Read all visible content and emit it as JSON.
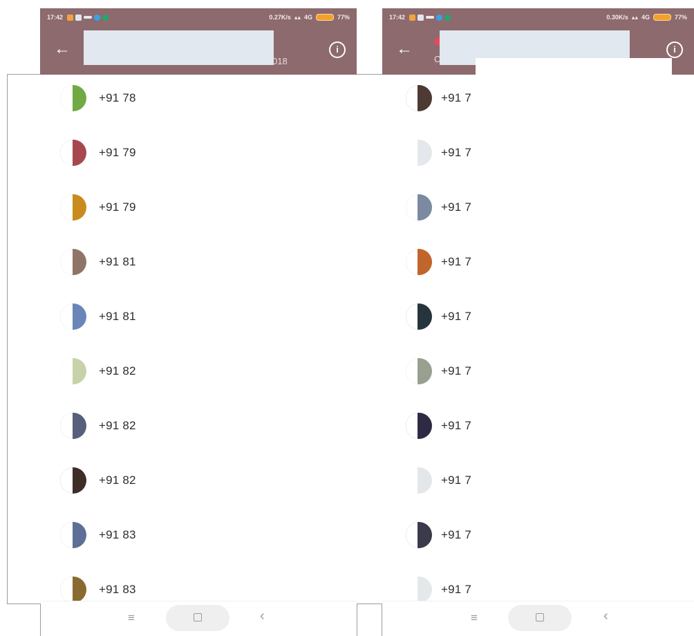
{
  "colors": {
    "header_bg": "#8d6a6d",
    "redaction": "#e1e8f0",
    "background": "#ffffff",
    "nav_icon": "#9a9a9a"
  },
  "icons": {
    "back": "arrow-left-icon",
    "info": "info-circle-icon",
    "nav_menu": "menu-lines-icon",
    "nav_home": "home-square-icon",
    "nav_back": "chevron-left-icon"
  },
  "left": {
    "status": {
      "time": "17:42",
      "speed": "0.27K/s",
      "signal": "4G",
      "battery": "77%"
    },
    "header": {
      "back_glyph": "←",
      "subtitle_fragment": "018",
      "info_glyph": "i"
    },
    "contacts": [
      {
        "number": "+91 78",
        "avatar": "#6faa44"
      },
      {
        "number": "+91 79",
        "avatar": "#a7484f"
      },
      {
        "number": "+91 79",
        "avatar": "#c98a1e"
      },
      {
        "number": "+91 81",
        "avatar": "#8f7468"
      },
      {
        "number": "+91 81",
        "avatar": "#6a86b8"
      },
      {
        "number": "+91 82",
        "avatar": "#c7d2a9"
      },
      {
        "number": "+91 82",
        "avatar": "#56607a"
      },
      {
        "number": "+91 82",
        "avatar": "#3f2e28"
      },
      {
        "number": "+91 83",
        "avatar": "#5e6f97"
      },
      {
        "number": "+91 83",
        "avatar": "#8a6a2f"
      }
    ],
    "nav": {
      "menu_glyph": "≡",
      "back_glyph": "‹"
    }
  },
  "right": {
    "status": {
      "time": "17:42",
      "speed": "0.30K/s",
      "signal": "4G",
      "battery": "77%"
    },
    "header": {
      "back_glyph": "←",
      "subtitle_fragment": "C",
      "info_glyph": "i"
    },
    "contacts": [
      {
        "number": "+91 7",
        "avatar": "#4d3a33"
      },
      {
        "number": "+91 7",
        "avatar": "#e4e8ec"
      },
      {
        "number": "+91 7",
        "avatar": "#7b8aa1"
      },
      {
        "number": "+91 7",
        "avatar": "#c0652c"
      },
      {
        "number": "+91 7",
        "avatar": "#26353d"
      },
      {
        "number": "+91 7",
        "avatar": "#9aa08f"
      },
      {
        "number": "+91 7",
        "avatar": "#2e2a44"
      },
      {
        "number": "+91 7",
        "avatar": "#e3e7ea"
      },
      {
        "number": "+91 7",
        "avatar": "#3a3a4a"
      },
      {
        "number": "+91 7",
        "avatar": "#e5e8eb"
      }
    ],
    "nav": {
      "menu_glyph": "≡",
      "back_glyph": "‹"
    }
  }
}
